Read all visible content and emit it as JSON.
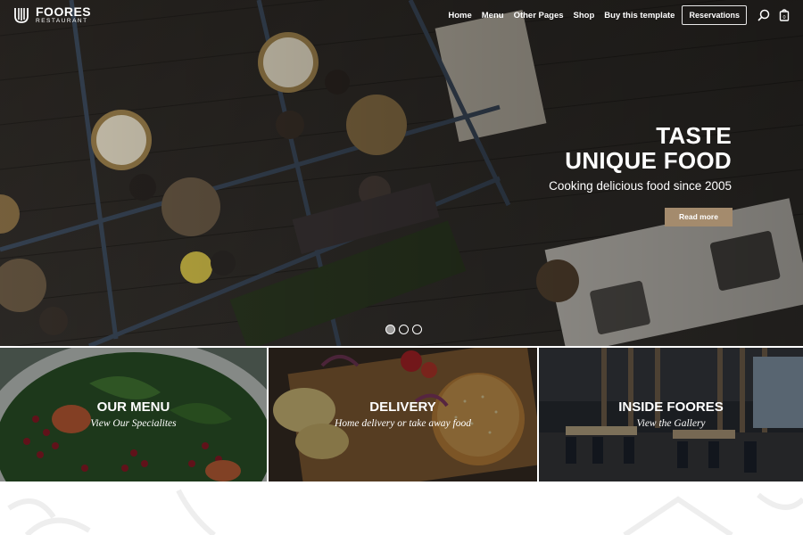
{
  "brand": {
    "name": "FOORES",
    "tagline": "RESTAURANT"
  },
  "nav": {
    "links": [
      "Home",
      "Menu",
      "Other Pages",
      "Shop",
      "Buy this template"
    ],
    "reservations_label": "Reservations",
    "cart_count": "0"
  },
  "hero": {
    "title_line1": "TASTE",
    "title_line2": "UNIQUE FOOD",
    "subtitle": "Cooking delicious food since 2005",
    "button_label": "Read more",
    "slides": 3,
    "active_slide": 1
  },
  "tiles": [
    {
      "title": "OUR MENU",
      "subtitle": "View Our Specialites"
    },
    {
      "title": "DELIVERY",
      "subtitle": "Home delivery or take away food"
    },
    {
      "title": "INSIDE FOORES",
      "subtitle": "View the Gallery"
    }
  ],
  "colors": {
    "accent": "#a48b6d",
    "nav_text": "#ffffff",
    "hero_dark": "#1f1c19"
  },
  "icons": [
    "logo-mark-icon",
    "search-icon",
    "cart-icon"
  ]
}
